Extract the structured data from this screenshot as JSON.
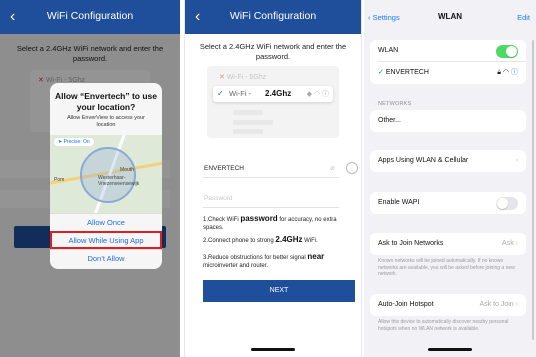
{
  "panel1": {
    "title": "WiFi Configuration",
    "back": "‹",
    "intro": "Select a 2.4GHz WiFi network and enter the password.",
    "network_band_ghost": "Wi-Fi - 5Ghz",
    "dialog": {
      "title": "Allow “Envertech” to use your location?",
      "subtitle": "Allow EnverView to access your location",
      "precise": "Precise: On",
      "map_label_1": "Mouth",
      "map_label_2": "Westerhaar-Vriezenveensewijk",
      "map_label_3": "Pom",
      "options": [
        "Allow Once",
        "Allow While Using App",
        "Don’t Allow"
      ]
    }
  },
  "panel2": {
    "title": "WiFi Configuration",
    "back": "‹",
    "intro": "Select a 2.4GHz WiFi network and enter the password.",
    "ghost_network": "Wi-Fi - 5Ghz",
    "selected_prefix": "Wi-Fi -",
    "selected_band": "2.4Ghz",
    "ssid_value": "ENVERTECH",
    "password_placeholder": "Password",
    "tips": [
      {
        "pre": "1.Check WiFi ",
        "bold": "password",
        "post": " for accuracy, no extra spaces."
      },
      {
        "pre": "2.Connect phone to strong ",
        "bold": "2.4GHz",
        "post": " WiFi."
      },
      {
        "pre": "3.Reduce obstructions for better signal ",
        "bold": "near",
        "post": " microinverter and router."
      }
    ],
    "next": "NEXT"
  },
  "panel3": {
    "back": "Settings",
    "title": "WLAN",
    "edit": "Edit",
    "wlan_label": "WLAN",
    "wlan_on": true,
    "connected": "ENVERTECH",
    "networks_header": "NETWORKS",
    "other": "Other...",
    "apps_row": "Apps Using WLAN & Cellular",
    "wapi_row": "Enable WAPI",
    "wapi_on": false,
    "ask_row": "Ask to Join Networks",
    "ask_value": "Ask",
    "ask_footer": "Known networks will be joined automatically. If no known networks are available, you will be asked before joining a new network.",
    "hotspot_row": "Auto-Join Hotspot",
    "hotspot_value": "Ask to Join",
    "hotspot_footer": "Allow this device to automatically discover nearby personal hotspots when no WLAN network is available."
  },
  "colors": {
    "brand": "#1f4e9a",
    "ios_link": "#1f7bf2",
    "highlight": "#e02020",
    "toggle_on": "#4cd964"
  }
}
